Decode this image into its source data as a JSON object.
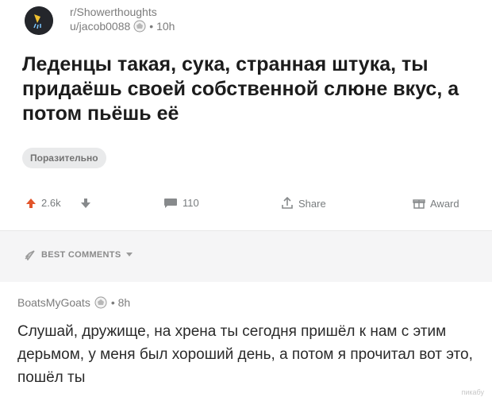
{
  "post": {
    "subreddit": "r/Showerthoughts",
    "user": "u/jacob0088",
    "time": "• 10h",
    "title": "Леденцы такая, сука, странная штука, ты придаёшь своей собственной слюне вкус, а потом пьёшь её",
    "flair": "Поразительно"
  },
  "actions": {
    "upvotes": "2.6k",
    "comments": "110",
    "share": "Share",
    "award": "Award"
  },
  "comments_header": {
    "label": "BEST COMMENTS"
  },
  "comment": {
    "user": "BoatsMyGoats",
    "time": "• 8h",
    "body": "Слушай, дружище, на хрена ты сегодня пришёл к нам с этим дерьмом, у меня был хороший день, а потом я прочитал вот это, пошёл ты"
  },
  "watermark": "пикабу",
  "colors": {
    "upvote": "#e2552b",
    "muted": "#7c7c7c",
    "flair_bg": "#e9eaeb",
    "divider_bg": "#f5f5f6"
  }
}
